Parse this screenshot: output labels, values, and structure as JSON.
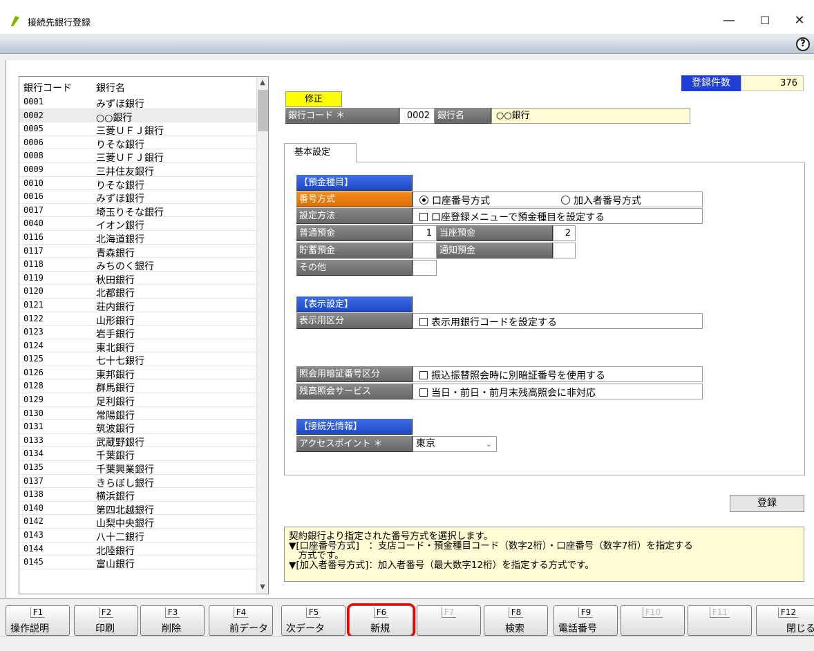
{
  "window": {
    "title": "接続先銀行登録",
    "minimize": "—",
    "maximize": "☐",
    "close": "✕",
    "help": "?"
  },
  "bank_list": {
    "col_code": "銀行コード",
    "col_name": "銀行名",
    "selected_code": "0002",
    "rows": [
      {
        "code": "0001",
        "name": "みずほ銀行"
      },
      {
        "code": "0002",
        "name": "○○銀行"
      },
      {
        "code": "0005",
        "name": "三菱ＵＦＪ銀行"
      },
      {
        "code": "0006",
        "name": "りそな銀行"
      },
      {
        "code": "0008",
        "name": "三菱ＵＦＪ銀行"
      },
      {
        "code": "0009",
        "name": "三井住友銀行"
      },
      {
        "code": "0010",
        "name": "りそな銀行"
      },
      {
        "code": "0016",
        "name": "みずほ銀行"
      },
      {
        "code": "0017",
        "name": "埼玉りそな銀行"
      },
      {
        "code": "0040",
        "name": "イオン銀行"
      },
      {
        "code": "0116",
        "name": "北海道銀行"
      },
      {
        "code": "0117",
        "name": "青森銀行"
      },
      {
        "code": "0118",
        "name": "みちのく銀行"
      },
      {
        "code": "0119",
        "name": "秋田銀行"
      },
      {
        "code": "0120",
        "name": "北都銀行"
      },
      {
        "code": "0121",
        "name": "荘内銀行"
      },
      {
        "code": "0122",
        "name": "山形銀行"
      },
      {
        "code": "0123",
        "name": "岩手銀行"
      },
      {
        "code": "0124",
        "name": "東北銀行"
      },
      {
        "code": "0125",
        "name": "七十七銀行"
      },
      {
        "code": "0126",
        "name": "東邦銀行"
      },
      {
        "code": "0128",
        "name": "群馬銀行"
      },
      {
        "code": "0129",
        "name": "足利銀行"
      },
      {
        "code": "0130",
        "name": "常陽銀行"
      },
      {
        "code": "0131",
        "name": "筑波銀行"
      },
      {
        "code": "0133",
        "name": "武蔵野銀行"
      },
      {
        "code": "0134",
        "name": "千葉銀行"
      },
      {
        "code": "0135",
        "name": "千葉興業銀行"
      },
      {
        "code": "0137",
        "name": "きらぼし銀行"
      },
      {
        "code": "0138",
        "name": "横浜銀行"
      },
      {
        "code": "0140",
        "name": "第四北越銀行"
      },
      {
        "code": "0142",
        "name": "山梨中央銀行"
      },
      {
        "code": "0143",
        "name": "八十二銀行"
      },
      {
        "code": "0144",
        "name": "北陸銀行"
      },
      {
        "code": "0145",
        "name": "富山銀行"
      }
    ]
  },
  "count": {
    "label": "登録件数",
    "value": "376"
  },
  "mode": "修正",
  "header": {
    "code_label": "銀行コード ＊",
    "code_value": "0002",
    "name_label": "銀行名",
    "name_value": "○○銀行"
  },
  "tab": {
    "label": "基本設定"
  },
  "deposit": {
    "section": "【預金種目】",
    "number_method_label": "番号方式",
    "opt_account": "口座番号方式",
    "opt_member": "加入者番号方式",
    "setting_label": "設定方法",
    "setting_check": "口座登録メニューで預金種目を設定する",
    "futsu_label": "普通預金",
    "futsu_value": "1",
    "toza_label": "当座預金",
    "toza_value": "2",
    "chochiku_label": "貯蓄預金",
    "chochiku_value": "",
    "tsuchi_label": "通知預金",
    "tsuchi_value": "",
    "other_label": "その他",
    "other_value": ""
  },
  "display": {
    "section": "【表示設定】",
    "kubun_label": "表示用区分",
    "kubun_check": "表示用銀行コードを設定する"
  },
  "inquiry": {
    "pin_label": "照会用暗証番号区分",
    "pin_check": "振込振替照会時に別暗証番号を使用する",
    "balance_label": "残高照会サービス",
    "balance_check": "当日・前日・前月末残高照会に非対応"
  },
  "connection": {
    "section": "【接続先情報】",
    "ap_label": "アクセスポイント ＊",
    "ap_value": "東京"
  },
  "register_button": "登録",
  "help_text": [
    "契約銀行より指定された番号方式を選択します。",
    "▼[口座番号方式]　：支店コード・預金種目コード（数字2桁）・口座番号（数字7桁）を指定する",
    "　方式です。",
    "▼[加入者番号方式]：加入者番号（最大数字12桁）を指定する方式です。"
  ],
  "fkeys": [
    {
      "key": "F1",
      "label": "操作説明"
    },
    {
      "key": "F2",
      "label": "印刷"
    },
    {
      "key": "F3",
      "label": "削除"
    },
    {
      "key": "F4",
      "label": "前データ"
    },
    {
      "key": "F5",
      "label": "次データ"
    },
    {
      "key": "F6",
      "label": "新規"
    },
    {
      "key": "F7",
      "label": ""
    },
    {
      "key": "F8",
      "label": "検索"
    },
    {
      "key": "F9",
      "label": "電話番号"
    },
    {
      "key": "F10",
      "label": ""
    },
    {
      "key": "F11",
      "label": ""
    },
    {
      "key": "F12",
      "label": "閉じる"
    }
  ],
  "colors": {
    "accent_blue": "#1f3fd6",
    "orange_label": "#e87a08",
    "highlight_red": "#e00000",
    "field_yellow": "#fffbd2",
    "mode_yellow": "#ffff00"
  }
}
